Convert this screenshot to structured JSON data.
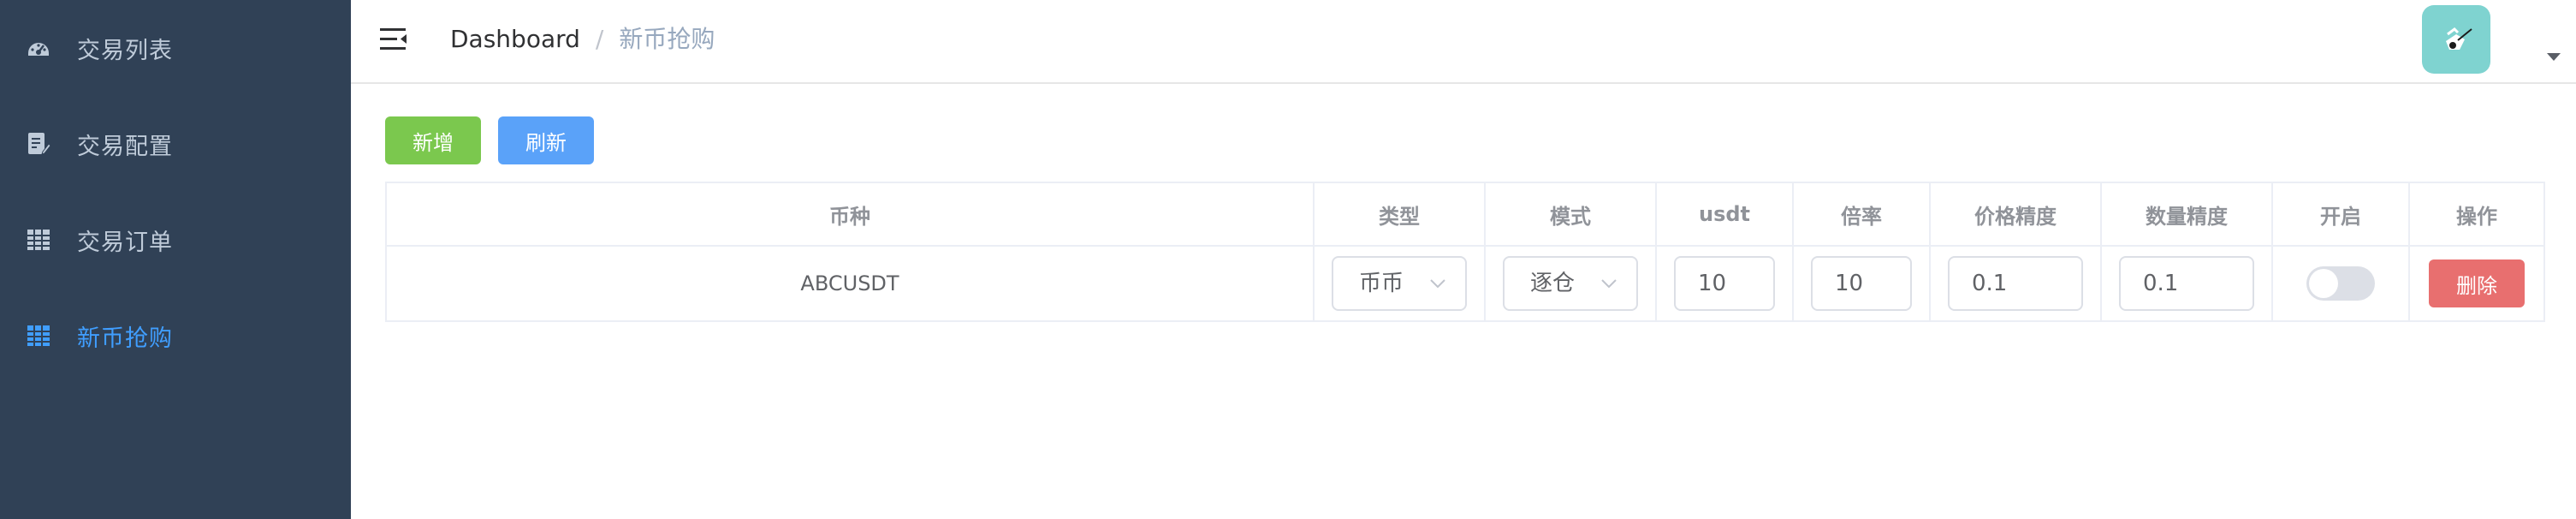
{
  "sidebar": {
    "items": [
      {
        "label": "交易列表",
        "icon": "dashboard-icon",
        "active": false
      },
      {
        "label": "交易配置",
        "icon": "form-edit-icon",
        "active": false
      },
      {
        "label": "交易订单",
        "icon": "table-icon",
        "active": false
      },
      {
        "label": "新币抢购",
        "icon": "table-icon",
        "active": true
      }
    ]
  },
  "header": {
    "breadcrumb": [
      "Dashboard",
      "新币抢购"
    ],
    "breadcrumb_separator": "/"
  },
  "toolbar": {
    "add_label": "新增",
    "refresh_label": "刷新"
  },
  "table": {
    "headers": [
      "币种",
      "类型",
      "模式",
      "usdt",
      "倍率",
      "价格精度",
      "数量精度",
      "开启",
      "操作"
    ],
    "rows": [
      {
        "symbol": "ABCUSDT",
        "type": "币币",
        "mode": "逐仓",
        "usdt": "10",
        "leverage": "10",
        "price_precision": "0.1",
        "quantity_precision": "0.1",
        "enabled": false,
        "action_label": "删除"
      }
    ]
  },
  "colors": {
    "sidebar_bg": "#304156",
    "sidebar_text": "#bfcbd9",
    "active": "#409eff",
    "add_button": "#7bc84e",
    "refresh_button": "#5aa2f9",
    "delete_button": "#e86f6f",
    "avatar_bg": "#7fd3d0"
  }
}
